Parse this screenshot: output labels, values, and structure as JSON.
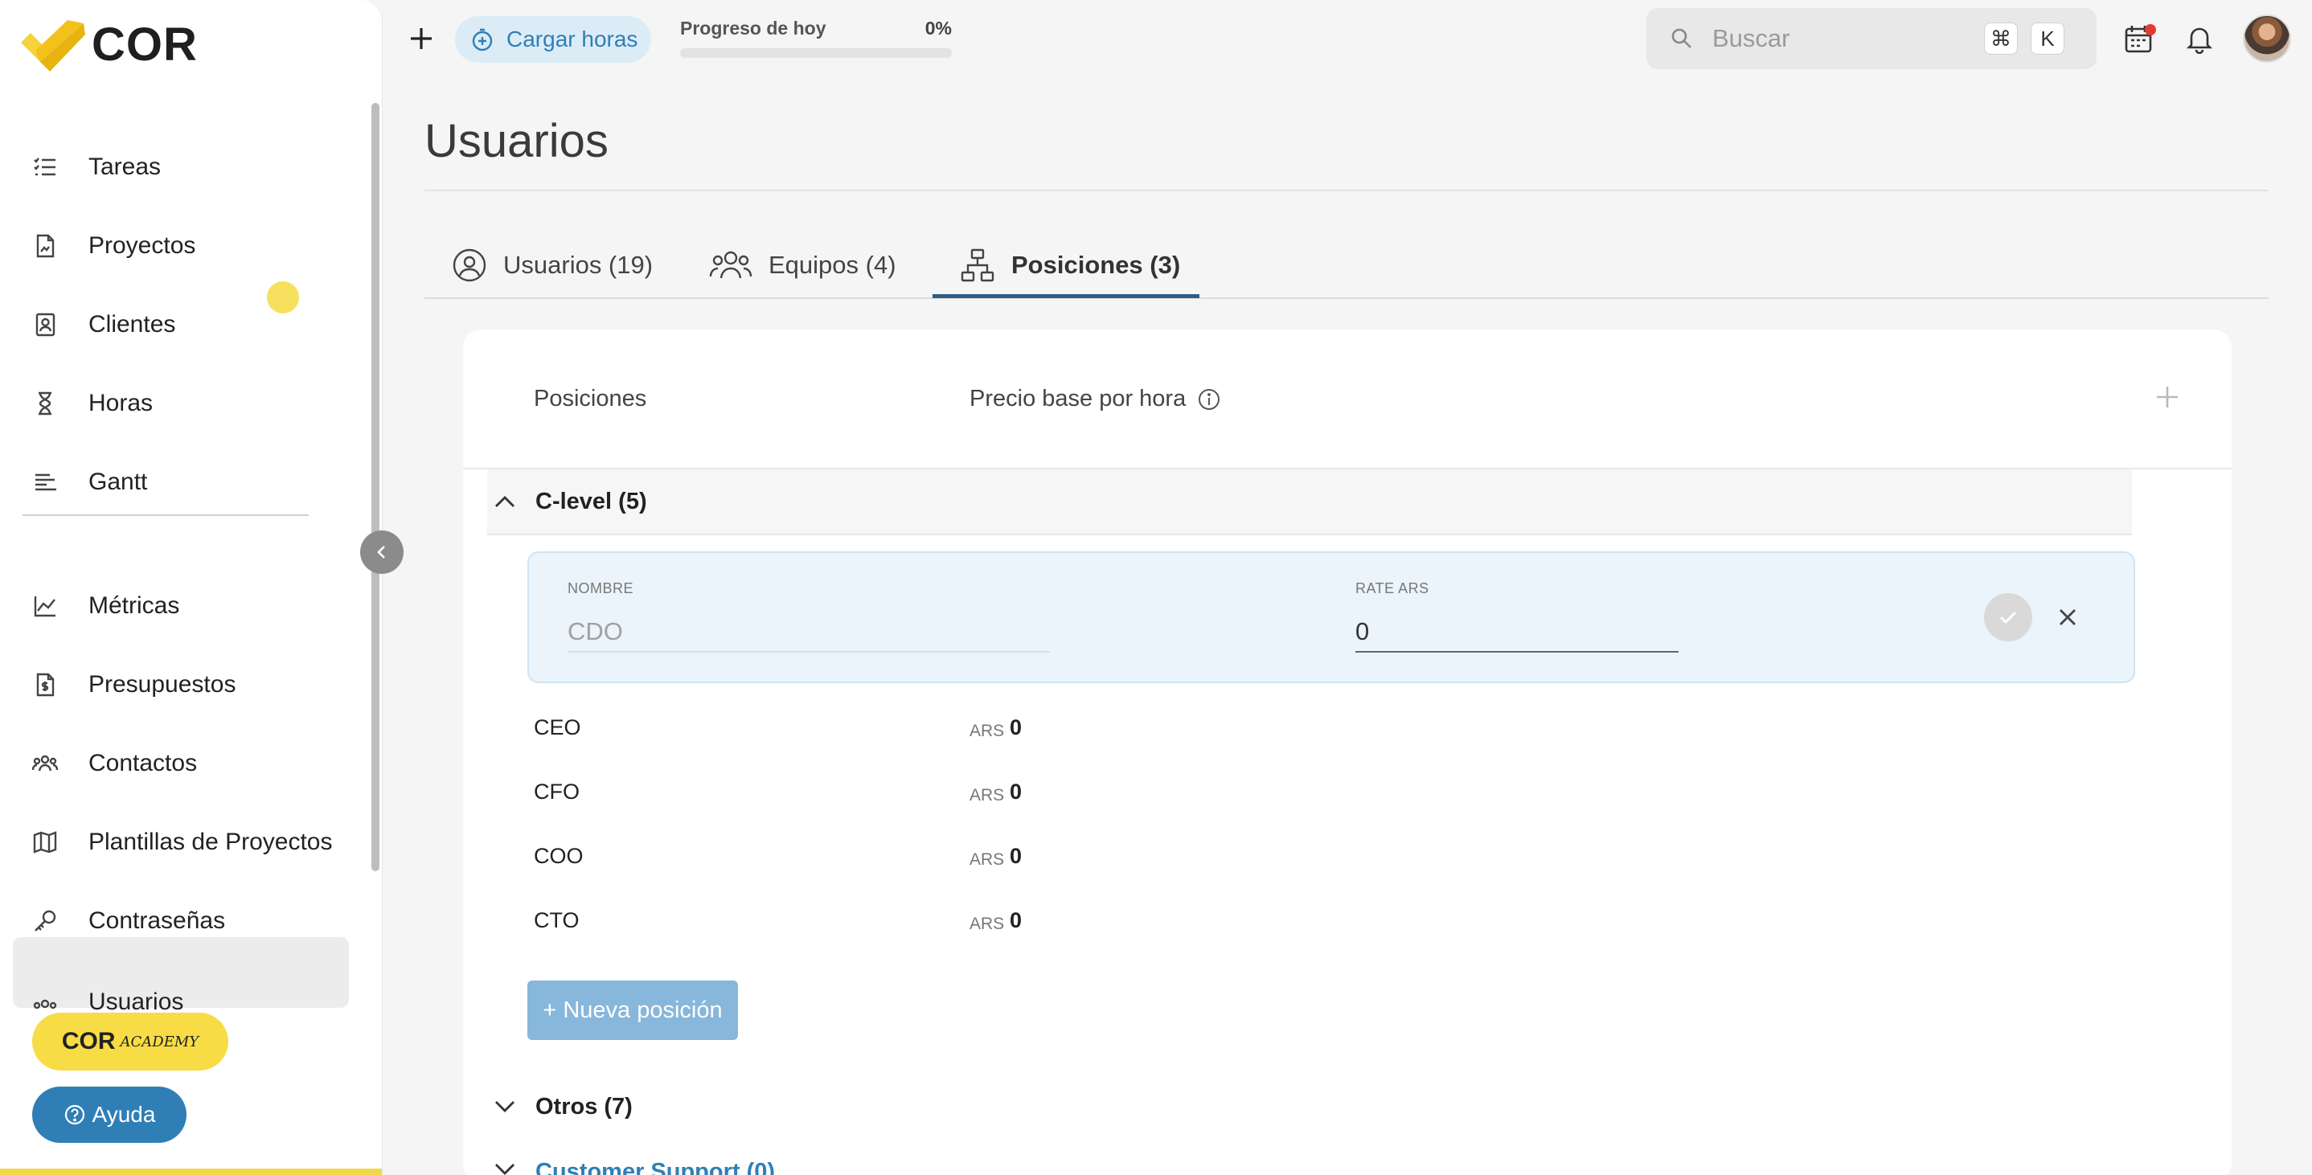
{
  "app": {
    "name": "COR"
  },
  "sidebar": {
    "items": [
      {
        "label": "Tareas",
        "icon": "tasks-icon"
      },
      {
        "label": "Proyectos",
        "icon": "projects-icon"
      },
      {
        "label": "Clientes",
        "icon": "clients-icon"
      },
      {
        "label": "Horas",
        "icon": "hourglass-icon"
      },
      {
        "label": "Gantt",
        "icon": "gantt-icon"
      },
      {
        "label": "Métricas",
        "icon": "metrics-icon"
      },
      {
        "label": "Presupuestos",
        "icon": "budget-icon"
      },
      {
        "label": "Contactos",
        "icon": "contacts-icon"
      },
      {
        "label": "Plantillas de Proyectos",
        "icon": "map-icon"
      },
      {
        "label": "Contraseñas",
        "icon": "key-icon"
      },
      {
        "label": "Usuarios",
        "icon": "users-icon"
      }
    ],
    "active_item": "Usuarios",
    "academy": {
      "main": "COR",
      "small": "ACADEMY"
    },
    "help_label": "Ayuda"
  },
  "topbar": {
    "load_hours_label": "Cargar horas",
    "progress_label": "Progreso de hoy",
    "progress_value": "0%",
    "progress_fraction": 0,
    "search_placeholder": "Buscar",
    "shortcut_keys": [
      "⌘",
      "K"
    ]
  },
  "page": {
    "title": "Usuarios",
    "tabs": [
      {
        "label": "Usuarios (19)",
        "icon": "user-circle-icon"
      },
      {
        "label": "Equipos (4)",
        "icon": "team-icon"
      },
      {
        "label": "Posiciones (3)",
        "icon": "org-chart-icon",
        "active": true
      }
    ]
  },
  "positions": {
    "columns": {
      "name": "Posiciones",
      "rate": "Precio base por hora"
    },
    "groups": [
      {
        "name": "C-level (5)",
        "expanded": true,
        "editing": {
          "name_label": "NOMBRE",
          "name_value": "CDO",
          "rate_label": "RATE ARS",
          "rate_value": "0"
        },
        "rows": [
          {
            "name": "CEO",
            "currency": "ARS",
            "value": "0"
          },
          {
            "name": "CFO",
            "currency": "ARS",
            "value": "0"
          },
          {
            "name": "COO",
            "currency": "ARS",
            "value": "0"
          },
          {
            "name": "CTO",
            "currency": "ARS",
            "value": "0"
          }
        ],
        "new_button": "+ Nueva posición"
      },
      {
        "name": "Otros (7)",
        "expanded": false
      },
      {
        "name": "Customer Support (0)",
        "expanded": false
      }
    ]
  },
  "colors": {
    "brand_yellow": "#f7dc45",
    "accent_blue": "#2f7fb6",
    "tab_underline": "#2f5d86"
  }
}
